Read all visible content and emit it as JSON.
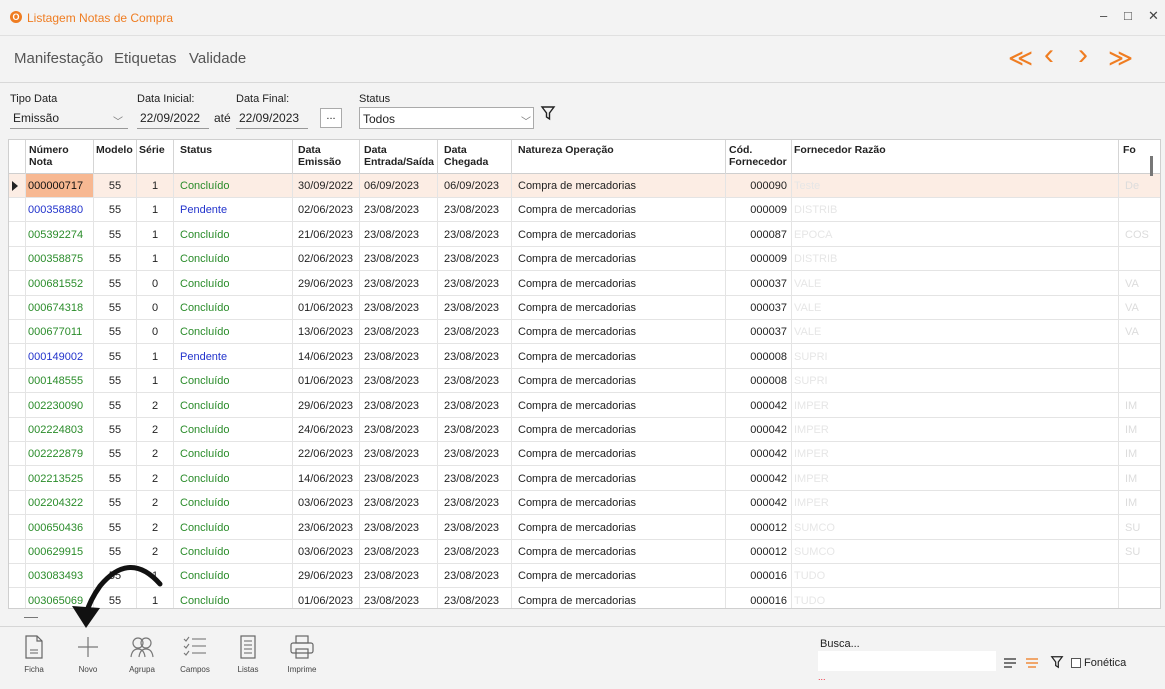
{
  "window": {
    "title": "Listagem Notas de Compra",
    "minimize": "–",
    "maximize": "□",
    "close": "✕"
  },
  "menu": {
    "items": [
      "Manifestação",
      "Etiquetas",
      "Validade"
    ]
  },
  "nav": {
    "first": "≪",
    "prev": "‹",
    "next": "›",
    "last": "≫",
    "accent_color": "#ef7d22"
  },
  "filters": {
    "tipo_data_label": "Tipo Data",
    "tipo_data_value": "Emissão",
    "data_inicial_label": "Data Inicial:",
    "data_inicial_value": "22/09/2022",
    "ate_label": "até",
    "data_final_label": "Data Final:",
    "data_final_value": "22/09/2023",
    "dots_label": "...",
    "status_label": "Status",
    "status_value": "Todos"
  },
  "columns": {
    "numero": "Número\nNota",
    "modelo": "Modelo",
    "serie": "Série",
    "status": "Status",
    "data_emissao": "Data\nEmissão",
    "data_entrada": "Data\nEntrada/Saída",
    "data_chegada": "Data\nChegada",
    "natureza": "Natureza Operação",
    "cod_fornecedor": "Cód.\nFornecedor",
    "fornecedor_razao": "Fornecedor Razão",
    "fo": "Fo"
  },
  "status_colors": {
    "Concluído": "#2a8c2a",
    "Pendente": "#2233cc"
  },
  "rows": [
    {
      "numero": "000000717",
      "modelo": "55",
      "serie": "1",
      "status": "Concluído",
      "emissao": "30/09/2022",
      "entrada": "06/09/2023",
      "chegada": "06/09/2023",
      "natureza": "Compra de mercadorias",
      "cod": "000090",
      "razao_hint": "Teste",
      "fo_hint": "De"
    },
    {
      "numero": "000358880",
      "modelo": "55",
      "serie": "1",
      "status": "Pendente",
      "emissao": "02/06/2023",
      "entrada": "23/08/2023",
      "chegada": "23/08/2023",
      "natureza": "Compra de mercadorias",
      "cod": "000009",
      "razao_hint": "DISTRIB",
      "fo_hint": ""
    },
    {
      "numero": "005392274",
      "modelo": "55",
      "serie": "1",
      "status": "Concluído",
      "emissao": "21/06/2023",
      "entrada": "23/08/2023",
      "chegada": "23/08/2023",
      "natureza": "Compra de mercadorias",
      "cod": "000087",
      "razao_hint": "EPOCA",
      "fo_hint": "COS"
    },
    {
      "numero": "000358875",
      "modelo": "55",
      "serie": "1",
      "status": "Concluído",
      "emissao": "02/06/2023",
      "entrada": "23/08/2023",
      "chegada": "23/08/2023",
      "natureza": "Compra de mercadorias",
      "cod": "000009",
      "razao_hint": "DISTRIB",
      "fo_hint": ""
    },
    {
      "numero": "000681552",
      "modelo": "55",
      "serie": "0",
      "status": "Concluído",
      "emissao": "29/06/2023",
      "entrada": "23/08/2023",
      "chegada": "23/08/2023",
      "natureza": "Compra de mercadorias",
      "cod": "000037",
      "razao_hint": "VALE",
      "fo_hint": "VA"
    },
    {
      "numero": "000674318",
      "modelo": "55",
      "serie": "0",
      "status": "Concluído",
      "emissao": "01/06/2023",
      "entrada": "23/08/2023",
      "chegada": "23/08/2023",
      "natureza": "Compra de mercadorias",
      "cod": "000037",
      "razao_hint": "VALE",
      "fo_hint": "VA"
    },
    {
      "numero": "000677011",
      "modelo": "55",
      "serie": "0",
      "status": "Concluído",
      "emissao": "13/06/2023",
      "entrada": "23/08/2023",
      "chegada": "23/08/2023",
      "natureza": "Compra de mercadorias",
      "cod": "000037",
      "razao_hint": "VALE",
      "fo_hint": "VA"
    },
    {
      "numero": "000149002",
      "modelo": "55",
      "serie": "1",
      "status": "Pendente",
      "emissao": "14/06/2023",
      "entrada": "23/08/2023",
      "chegada": "23/08/2023",
      "natureza": "Compra de mercadorias",
      "cod": "000008",
      "razao_hint": "SUPRI",
      "fo_hint": ""
    },
    {
      "numero": "000148555",
      "modelo": "55",
      "serie": "1",
      "status": "Concluído",
      "emissao": "01/06/2023",
      "entrada": "23/08/2023",
      "chegada": "23/08/2023",
      "natureza": "Compra de mercadorias",
      "cod": "000008",
      "razao_hint": "SUPRI",
      "fo_hint": ""
    },
    {
      "numero": "002230090",
      "modelo": "55",
      "serie": "2",
      "status": "Concluído",
      "emissao": "29/06/2023",
      "entrada": "23/08/2023",
      "chegada": "23/08/2023",
      "natureza": "Compra de mercadorias",
      "cod": "000042",
      "razao_hint": "IMPER",
      "fo_hint": "IM"
    },
    {
      "numero": "002224803",
      "modelo": "55",
      "serie": "2",
      "status": "Concluído",
      "emissao": "24/06/2023",
      "entrada": "23/08/2023",
      "chegada": "23/08/2023",
      "natureza": "Compra de mercadorias",
      "cod": "000042",
      "razao_hint": "IMPER",
      "fo_hint": "IM"
    },
    {
      "numero": "002222879",
      "modelo": "55",
      "serie": "2",
      "status": "Concluído",
      "emissao": "22/06/2023",
      "entrada": "23/08/2023",
      "chegada": "23/08/2023",
      "natureza": "Compra de mercadorias",
      "cod": "000042",
      "razao_hint": "IMPER",
      "fo_hint": "IM"
    },
    {
      "numero": "002213525",
      "modelo": "55",
      "serie": "2",
      "status": "Concluído",
      "emissao": "14/06/2023",
      "entrada": "23/08/2023",
      "chegada": "23/08/2023",
      "natureza": "Compra de mercadorias",
      "cod": "000042",
      "razao_hint": "IMPER",
      "fo_hint": "IM"
    },
    {
      "numero": "002204322",
      "modelo": "55",
      "serie": "2",
      "status": "Concluído",
      "emissao": "03/06/2023",
      "entrada": "23/08/2023",
      "chegada": "23/08/2023",
      "natureza": "Compra de mercadorias",
      "cod": "000042",
      "razao_hint": "IMPER",
      "fo_hint": "IM"
    },
    {
      "numero": "000650436",
      "modelo": "55",
      "serie": "2",
      "status": "Concluído",
      "emissao": "23/06/2023",
      "entrada": "23/08/2023",
      "chegada": "23/08/2023",
      "natureza": "Compra de mercadorias",
      "cod": "000012",
      "razao_hint": "SUMCO",
      "fo_hint": "SU"
    },
    {
      "numero": "000629915",
      "modelo": "55",
      "serie": "2",
      "status": "Concluído",
      "emissao": "03/06/2023",
      "entrada": "23/08/2023",
      "chegada": "23/08/2023",
      "natureza": "Compra de mercadorias",
      "cod": "000012",
      "razao_hint": "SUMCO",
      "fo_hint": "SU"
    },
    {
      "numero": "003083493",
      "modelo": "55",
      "serie": "1",
      "status": "Concluído",
      "emissao": "29/06/2023",
      "entrada": "23/08/2023",
      "chegada": "23/08/2023",
      "natureza": "Compra de mercadorias",
      "cod": "000016",
      "razao_hint": "TUDO",
      "fo_hint": ""
    },
    {
      "numero": "003065069",
      "modelo": "55",
      "serie": "1",
      "status": "Concluído",
      "emissao": "01/06/2023",
      "entrada": "23/08/2023",
      "chegada": "23/08/2023",
      "natureza": "Compra de mercadorias",
      "cod": "000016",
      "razao_hint": "TUDO",
      "fo_hint": ""
    }
  ],
  "toolbar": {
    "buttons": [
      {
        "label": "Ficha",
        "icon": "document-icon"
      },
      {
        "label": "Novo",
        "icon": "plus-icon"
      },
      {
        "label": "Agrupa",
        "icon": "group-icon"
      },
      {
        "label": "Campos",
        "icon": "checklist-icon"
      },
      {
        "label": "Listas",
        "icon": "list-icon"
      },
      {
        "label": "Imprime",
        "icon": "printer-icon"
      }
    ]
  },
  "search": {
    "label": "Busca...",
    "value": "",
    "dots": "...",
    "fonetica_label": "Fonética"
  }
}
